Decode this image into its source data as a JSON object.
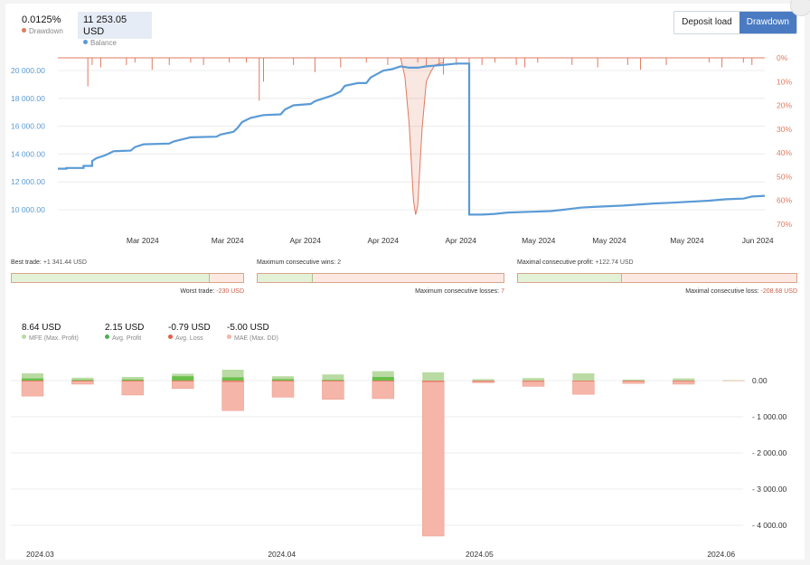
{
  "header": {
    "drawdown": {
      "value": "0.0125%",
      "label": "Drawdown",
      "color": "#e07a5f"
    },
    "balance": {
      "value": "11 253.05 USD",
      "label": "Balance",
      "color": "#5b9bd5"
    },
    "buttons": {
      "deposit_load": "Deposit load",
      "drawdown": "Drawdown"
    }
  },
  "stats": {
    "best_trade": {
      "label": "Best trade:",
      "value": "+1 341.44 USD",
      "fraction": 0.85
    },
    "worst_trade": {
      "label": "Worst trade:",
      "value": "-230 USD"
    },
    "max_consec_wins": {
      "label": "Maximum consecutive wins:",
      "value": "2",
      "fraction": 0.22
    },
    "max_consec_losses": {
      "label": "Maximum consecutive losses:",
      "value": "7"
    },
    "max_consec_profit": {
      "label": "Maximal consecutive profit:",
      "value": "+122.74 USD",
      "fraction": 0.37
    },
    "max_consec_loss": {
      "label": "Maximal consecutive loss:",
      "value": "-208.68 USD"
    }
  },
  "summary": [
    {
      "value": "8.64 USD",
      "label": "MFE (Max. Profit)",
      "color": "#b9dba3"
    },
    {
      "value": "2.15 USD",
      "label": "Avg. Profit",
      "color": "#4caf50"
    },
    {
      "value": "-0.79 USD",
      "label": "Avg. Loss",
      "color": "#e0604a"
    },
    {
      "value": "-5.00 USD",
      "label": "MAE (Max. DD)",
      "color": "#f5b5a8"
    }
  ],
  "chart_data": [
    {
      "type": "line",
      "y_left": {
        "ticks": [
          "10 000.00",
          "12 000.00",
          "14 000.00",
          "16 000.00",
          "18 000.00",
          "20 000.00"
        ],
        "tick_values": [
          10000,
          12000,
          14000,
          16000,
          18000,
          20000
        ]
      },
      "y_right": {
        "ticks": [
          "0%",
          "10%",
          "20%",
          "30%",
          "40%",
          "50%",
          "60%",
          "70%"
        ],
        "tick_values": [
          0,
          10,
          20,
          30,
          40,
          50,
          60,
          70
        ]
      },
      "x_ticks": [
        "Mar 2024",
        "Mar 2024",
        "Apr 2024",
        "Apr 2024",
        "Apr 2024",
        "May 2024",
        "May 2024",
        "May 2024",
        "Jun 2024"
      ],
      "x_tick_pos": [
        0.12,
        0.24,
        0.35,
        0.46,
        0.57,
        0.68,
        0.78,
        0.89,
        0.99
      ],
      "series": [
        {
          "name": "Balance",
          "color": "#5b9bd5",
          "points": [
            [
              0.0,
              12950
            ],
            [
              0.02,
              12950
            ],
            [
              0.02,
              13000
            ],
            [
              0.06,
              13000
            ],
            [
              0.06,
              13150
            ],
            [
              0.08,
              13150
            ],
            [
              0.08,
              13500
            ],
            [
              0.09,
              13700
            ],
            [
              0.11,
              13900
            ],
            [
              0.12,
              14050
            ],
            [
              0.13,
              14200
            ],
            [
              0.17,
              14250
            ],
            [
              0.18,
              14500
            ],
            [
              0.2,
              14700
            ],
            [
              0.26,
              14750
            ],
            [
              0.27,
              14900
            ],
            [
              0.29,
              15050
            ],
            [
              0.31,
              15200
            ],
            [
              0.37,
              15250
            ],
            [
              0.38,
              15400
            ],
            [
              0.41,
              15600
            ],
            [
              0.42,
              15900
            ],
            [
              0.43,
              16300
            ],
            [
              0.45,
              16600
            ],
            [
              0.48,
              16800
            ],
            [
              0.52,
              16850
            ],
            [
              0.53,
              17200
            ],
            [
              0.55,
              17500
            ],
            [
              0.59,
              17600
            ],
            [
              0.6,
              17800
            ],
            [
              0.62,
              18000
            ],
            [
              0.64,
              18200
            ],
            [
              0.66,
              18500
            ],
            [
              0.67,
              18900
            ],
            [
              0.7,
              19100
            ],
            [
              0.72,
              19100
            ],
            [
              0.73,
              19500
            ],
            [
              0.76,
              20000
            ],
            [
              0.78,
              20100
            ],
            [
              0.8,
              20300
            ],
            [
              0.82,
              20200
            ],
            [
              0.84,
              20200
            ],
            [
              0.86,
              20300
            ],
            [
              0.9,
              20400
            ],
            [
              0.93,
              20500
            ],
            [
              0.96,
              20500
            ],
            [
              0.96,
              9650
            ],
            [
              0.99,
              9650
            ],
            [
              1.02,
              9700
            ],
            [
              1.05,
              9800
            ],
            [
              1.1,
              9850
            ],
            [
              1.15,
              9900
            ],
            [
              1.18,
              10000
            ],
            [
              1.22,
              10150
            ],
            [
              1.25,
              10200
            ],
            [
              1.32,
              10300
            ],
            [
              1.39,
              10450
            ],
            [
              1.43,
              10500
            ],
            [
              1.52,
              10650
            ],
            [
              1.56,
              10750
            ],
            [
              1.6,
              10800
            ],
            [
              1.62,
              10950
            ],
            [
              1.65,
              11000
            ]
          ],
          "x_domain": [
            0,
            1.65
          ]
        },
        {
          "name": "Drawdown",
          "color": "#e07a5f",
          "spikes": [
            [
              0.07,
              12
            ],
            [
              0.08,
              3
            ],
            [
              0.1,
              4
            ],
            [
              0.16,
              3
            ],
            [
              0.18,
              2
            ],
            [
              0.22,
              5
            ],
            [
              0.26,
              3
            ],
            [
              0.31,
              2
            ],
            [
              0.34,
              3
            ],
            [
              0.4,
              2
            ],
            [
              0.44,
              2
            ],
            [
              0.47,
              18
            ],
            [
              0.48,
              10
            ],
            [
              0.55,
              3
            ],
            [
              0.6,
              6
            ],
            [
              0.66,
              4
            ],
            [
              0.72,
              2
            ],
            [
              0.77,
              3
            ],
            [
              0.84,
              2
            ],
            [
              0.86,
              4
            ],
            [
              0.89,
              3
            ],
            [
              0.9,
              7
            ],
            [
              0.93,
              3
            ],
            [
              0.96,
              8
            ],
            [
              0.99,
              3
            ],
            [
              1.02,
              2
            ],
            [
              1.07,
              3
            ],
            [
              1.09,
              4
            ],
            [
              1.12,
              2
            ],
            [
              1.2,
              3
            ],
            [
              1.26,
              4
            ],
            [
              1.33,
              3
            ],
            [
              1.36,
              5
            ],
            [
              1.42,
              3
            ],
            [
              1.52,
              2
            ],
            [
              1.55,
              4
            ],
            [
              1.6,
              2
            ],
            [
              1.62,
              3
            ]
          ],
          "big_dd": [
            [
              0.8,
              0
            ],
            [
              0.81,
              8
            ],
            [
              0.82,
              28
            ],
            [
              0.83,
              60
            ],
            [
              0.835,
              66
            ],
            [
              0.84,
              62
            ],
            [
              0.85,
              30
            ],
            [
              0.86,
              10
            ],
            [
              0.87,
              6
            ],
            [
              0.88,
              3
            ],
            [
              0.9,
              2
            ]
          ],
          "x_domain": [
            0,
            1.65
          ]
        }
      ]
    },
    {
      "type": "bar",
      "x_ticks": [
        "2024.03",
        "2024.04",
        "2024.05",
        "2024.06"
      ],
      "x_tick_pos": [
        0.04,
        0.37,
        0.64,
        0.97
      ],
      "y_ticks": [
        "0.00",
        "- 1 000.00",
        "- 2 000.00",
        "- 3 000.00",
        "- 4 000.00"
      ],
      "ylim": [
        -4300,
        300
      ],
      "series": [
        {
          "name": "MFE (Max. Profit)",
          "color": "#b9dba3",
          "values": [
            200,
            80,
            100,
            190,
            300,
            120,
            170,
            260,
            230,
            40,
            70,
            200,
            30,
            60,
            10
          ]
        },
        {
          "name": "Avg. Profit",
          "color": "#6abf4b",
          "values": [
            60,
            20,
            30,
            120,
            90,
            40,
            20,
            100,
            0,
            0,
            0,
            0,
            0,
            0,
            0
          ]
        },
        {
          "name": "Avg. Loss",
          "color": "#e0604a",
          "values": [
            -20,
            -10,
            -10,
            -20,
            -40,
            -10,
            -20,
            -20,
            -40,
            -30,
            -30,
            -20,
            -20,
            -20,
            0
          ]
        },
        {
          "name": "MAE (Max. DD)",
          "color": "#f5b5a8",
          "values": [
            -430,
            -100,
            -400,
            -220,
            -830,
            -460,
            -520,
            -500,
            -4300,
            -60,
            -160,
            -380,
            -80,
            -100,
            -5
          ]
        }
      ]
    }
  ]
}
